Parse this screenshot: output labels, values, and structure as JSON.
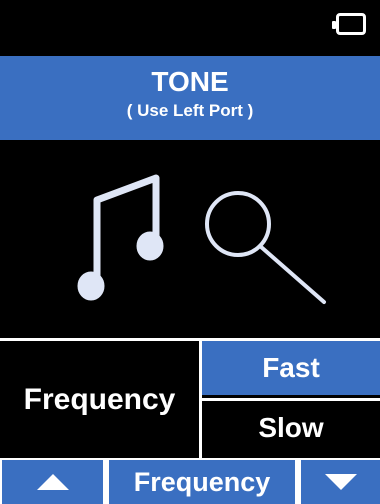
{
  "status": {
    "battery_icon": "battery-icon"
  },
  "header": {
    "title": "TONE",
    "subtitle": "( Use Left Port )"
  },
  "graphic": {
    "icons": [
      "music-note-icon",
      "search-icon"
    ]
  },
  "mode": {
    "label": "Frequency",
    "options": [
      {
        "label": "Fast",
        "selected": true
      },
      {
        "label": "Slow",
        "selected": false
      }
    ]
  },
  "footer": {
    "up_icon": "triangle-up-icon",
    "center_label": "Frequency",
    "down_icon": "triangle-down-icon"
  },
  "colors": {
    "accent": "#3a6fc1",
    "background": "#000000",
    "text": "#ffffff"
  }
}
